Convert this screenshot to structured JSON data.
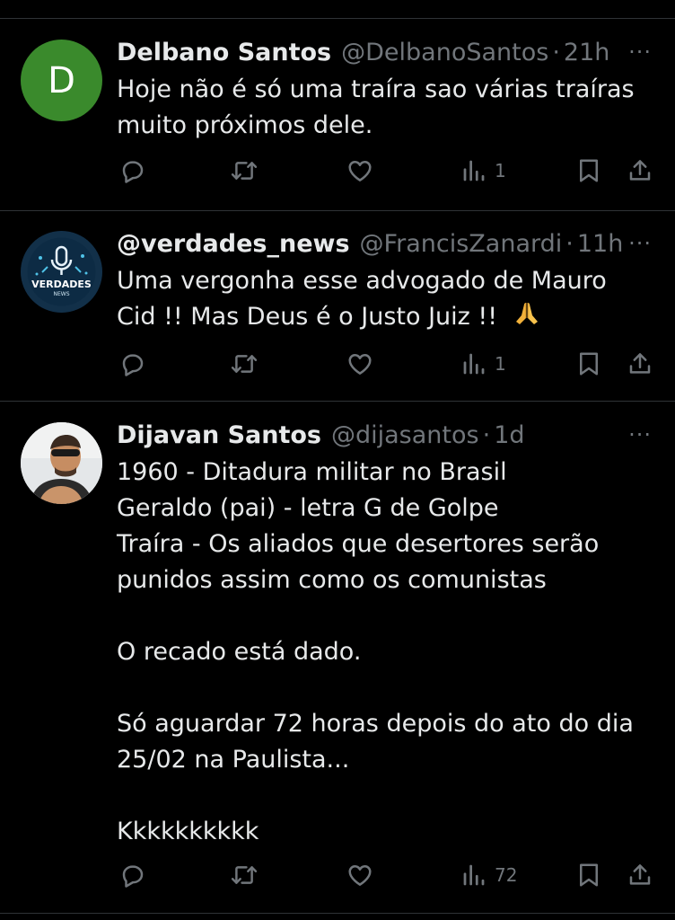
{
  "tweets": [
    {
      "name": "Delbano Santos",
      "handle": "@DelbanoSantos",
      "sep": "·",
      "time": "21h",
      "avatar_letter": "D",
      "lines": [
        "Hoje não é só uma traíra sao  várias traíras",
        "muito próximos dele."
      ],
      "views": "1"
    },
    {
      "name": "@verdades_news",
      "handle": "@FrancisZanardi",
      "sep": "·",
      "time": "11h",
      "avatar_logo_text": "VERDADES",
      "avatar_logo_sub": "NEWS",
      "lines": [
        "Uma vergonha esse advogado de Mauro",
        "Cid !! Mas Deus é  o Justo Juiz !!"
      ],
      "views": "1"
    },
    {
      "name": "Dijavan Santos",
      "handle": "@dijasantos",
      "sep": "·",
      "time": "1d",
      "lines": [
        "1960 - Ditadura militar no Brasil",
        "Geraldo (pai) - letra G de Golpe",
        "Traíra - Os aliados que desertores serão",
        "punidos assim como os comunistas",
        "",
        "O recado está dado.",
        "",
        "Só aguardar 72 horas depois do ato do dia",
        "25/02 na Paulista...",
        "",
        "Kkkkkkkkkk"
      ],
      "views": "72"
    }
  ],
  "more_glyph": "···",
  "icons": [
    "reply-icon",
    "retweet-icon",
    "like-icon",
    "views-icon",
    "bookmark-icon",
    "share-icon"
  ],
  "colors": {
    "background": "#000000",
    "text": "#e7e9ea",
    "muted": "#71767b",
    "divider": "#2f3336",
    "avatar_d": "#3a8a2c"
  }
}
